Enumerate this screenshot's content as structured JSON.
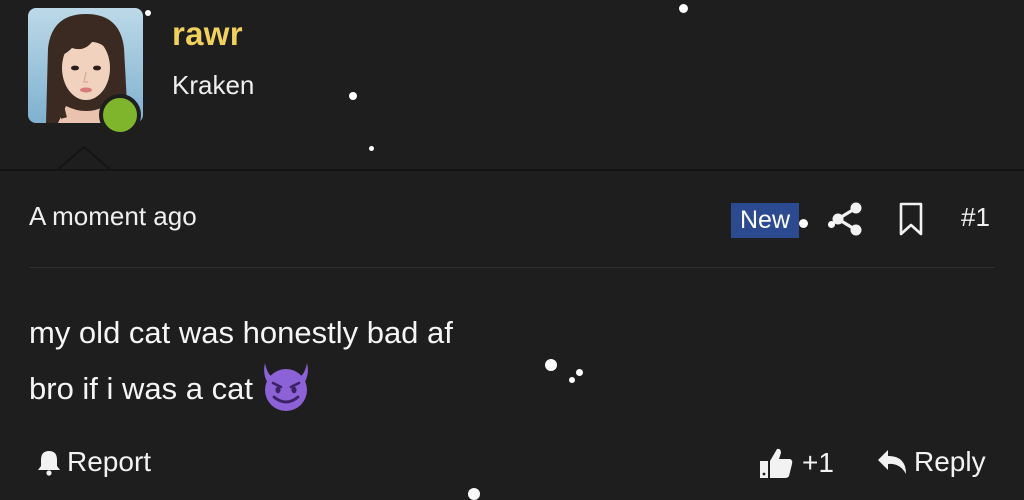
{
  "user": {
    "name": "rawr",
    "title": "Kraken",
    "online_status_color": "#7fb52d",
    "name_color": "#f0d160"
  },
  "post": {
    "timestamp": "A moment ago",
    "new_badge": "New",
    "post_number": "#1",
    "message_lines": [
      "my old cat was honestly bad af",
      "bro if i was a cat"
    ],
    "emoji": "smiling-devil"
  },
  "actions": {
    "report_label": "Report",
    "like_count": "+1",
    "reply_label": "Reply"
  },
  "icons": {
    "share": "share-icon",
    "bookmark": "bookmark-icon",
    "report": "bell-icon",
    "like": "thumbs-up-icon",
    "reply": "reply-arrow-icon"
  },
  "colors": {
    "background": "#1e1e1f",
    "badge": "#2c4a8f",
    "emoji_purple": "#8c62d6"
  }
}
